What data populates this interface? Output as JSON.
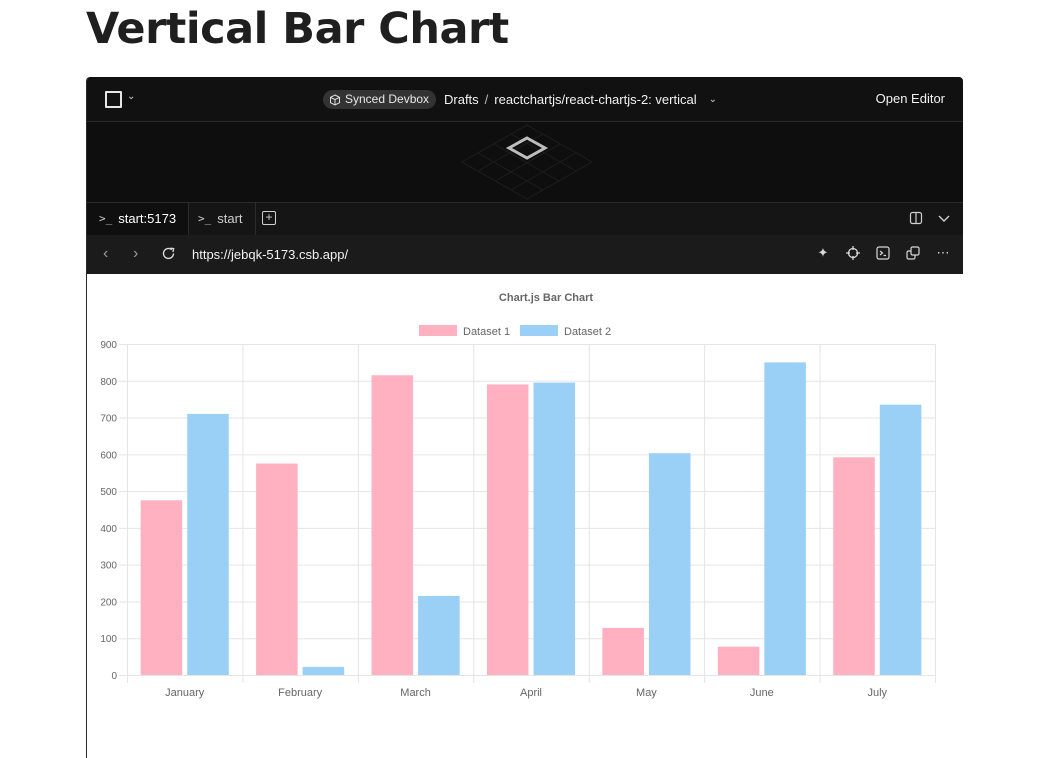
{
  "page": {
    "heading": "Vertical Bar Chart"
  },
  "topbar": {
    "synced_label": "Synced Devbox",
    "breadcrumb": {
      "root": "Drafts",
      "separator": "/",
      "sandbox": "reactchartjs/react-chartjs-2: vertical"
    },
    "open_editor_label": "Open Editor"
  },
  "tabs": [
    {
      "label": "start:5173",
      "active": true
    },
    {
      "label": "start",
      "active": false
    }
  ],
  "browser": {
    "url": "https://jebqk-5173.csb.app/"
  },
  "colors": {
    "dataset1_fill": "#ffb1c1",
    "dataset2_fill": "#9ad0f5",
    "toolbar_bg": "#111111",
    "grid": "#e5e5e5"
  },
  "icons": [
    "menu-square-icon",
    "box-icon",
    "terminal-icon",
    "plus-icon",
    "split-view-icon",
    "chevron-down-icon",
    "back-icon",
    "forward-icon",
    "reload-icon",
    "sparkle-icon",
    "crosshair-icon",
    "console-icon",
    "popout-icon",
    "more-icon"
  ],
  "chart_data": {
    "type": "bar",
    "title": "Chart.js Bar Chart",
    "categories": [
      "January",
      "February",
      "March",
      "April",
      "May",
      "June",
      "July"
    ],
    "series": [
      {
        "name": "Dataset 1",
        "values": [
          475,
          575,
          815,
          790,
          128,
          77,
          592
        ]
      },
      {
        "name": "Dataset 2",
        "values": [
          710,
          22,
          215,
          795,
          603,
          850,
          735
        ]
      }
    ],
    "ylim": [
      0,
      900
    ],
    "yticks": [
      0,
      100,
      200,
      300,
      400,
      500,
      600,
      700,
      800,
      900
    ],
    "legend": "top",
    "grid": true
  }
}
